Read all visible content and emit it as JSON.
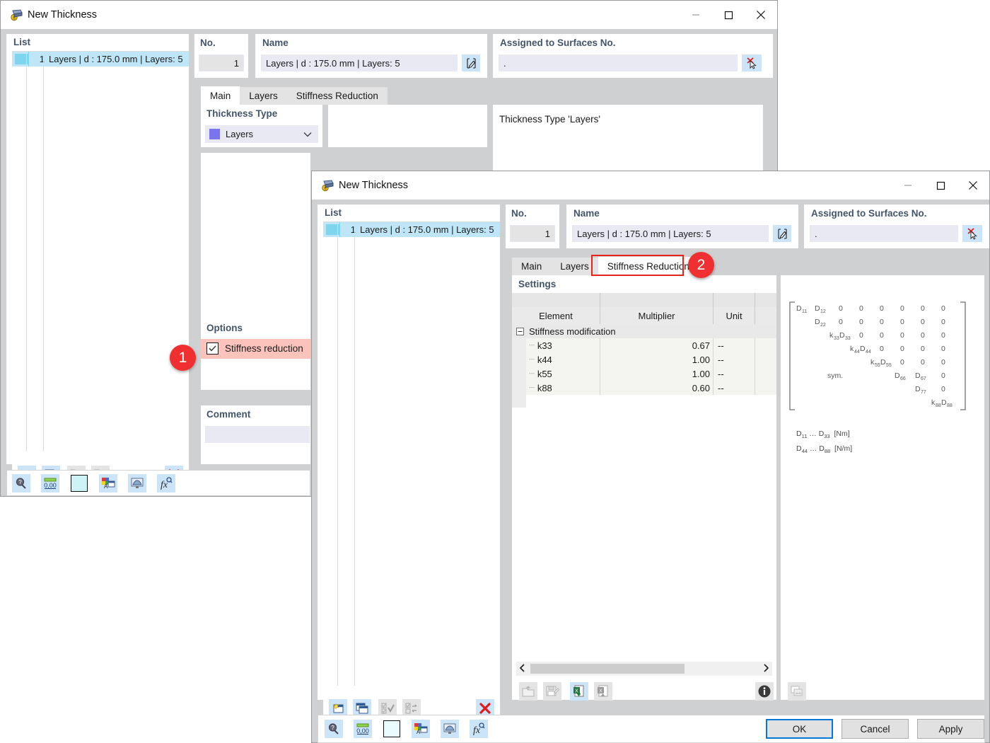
{
  "window_back": {
    "title": "New Thickness",
    "icon": "thickness-icon",
    "minimize": "minimize-icon",
    "maximize": "maximize-icon",
    "close": "close-icon",
    "list": {
      "title": "List",
      "rows": [
        {
          "num": "1",
          "label": "Layers | d : 175.0 mm | Layers: 5"
        }
      ]
    },
    "no": {
      "title": "No.",
      "value": "1"
    },
    "name": {
      "title": "Name",
      "value": "Layers | d : 175.0 mm | Layers: 5",
      "edit_icon": "edit-pencil-icon"
    },
    "assigned": {
      "title": "Assigned to Surfaces No.",
      "value": ".",
      "pick_icon": "pick-surface-icon"
    },
    "tabs": [
      {
        "label": "Main",
        "active": true
      },
      {
        "label": "Layers",
        "active": false
      },
      {
        "label": "Stiffness Reduction",
        "active": false
      }
    ],
    "thickness_type": {
      "title": "Thickness Type",
      "value": "Layers",
      "chevron": "chevron-down-icon"
    },
    "info_text": "Thickness Type  'Layers'",
    "options": {
      "title": "Options",
      "checkbox_label": "Stiffness reduction",
      "checked": true
    },
    "comment": {
      "title": "Comment",
      "value": ""
    },
    "list_toolbar": [
      {
        "icon": "new-item-icon",
        "enabled": true
      },
      {
        "icon": "copy-item-icon",
        "enabled": true
      },
      {
        "icon": "select-all-icon",
        "enabled": false
      },
      {
        "icon": "invert-selection-icon",
        "enabled": false
      },
      {
        "icon": "delete-red-x-icon",
        "enabled": true
      }
    ],
    "bottom_toolbar": [
      {
        "icon": "search-magnifier-icon"
      },
      {
        "icon": "units-00-icon"
      },
      {
        "icon": "color-swatch-icon"
      },
      {
        "icon": "display-properties-icon"
      },
      {
        "icon": "render-view-icon"
      },
      {
        "icon": "formula-fx-icon"
      }
    ]
  },
  "window_front": {
    "title": "New Thickness",
    "icon": "thickness-icon",
    "minimize": "minimize-icon",
    "maximize": "maximize-icon",
    "close": "close-icon",
    "list": {
      "title": "List",
      "rows": [
        {
          "num": "1",
          "label": "Layers | d : 175.0 mm | Layers: 5"
        }
      ]
    },
    "no": {
      "title": "No.",
      "value": "1"
    },
    "name": {
      "title": "Name",
      "value": "Layers | d : 175.0 mm | Layers: 5",
      "edit_icon": "edit-pencil-icon"
    },
    "assigned": {
      "title": "Assigned to Surfaces No.",
      "value": ".",
      "pick_icon": "pick-surface-icon"
    },
    "tabs": [
      {
        "label": "Main",
        "active": false
      },
      {
        "label": "Layers",
        "active": false
      },
      {
        "label": "Stiffness Reduction",
        "active": true
      }
    ],
    "settings": {
      "title": "Settings",
      "columns": [
        "Element",
        "Multiplier",
        "Unit"
      ],
      "group": {
        "label": "Stiffness modification",
        "expander": "collapse-minus-icon"
      },
      "rows": [
        {
          "element": "k33",
          "multiplier": "0.67",
          "unit": "--"
        },
        {
          "element": "k44",
          "multiplier": "1.00",
          "unit": "--"
        },
        {
          "element": "k55",
          "multiplier": "1.00",
          "unit": "--"
        },
        {
          "element": "k88",
          "multiplier": "0.60",
          "unit": "--"
        }
      ]
    },
    "matrix": {
      "rows": [
        [
          "D11",
          "D12",
          "0",
          "0",
          "0",
          "0",
          "0",
          "0"
        ],
        [
          "",
          "D22",
          "0",
          "0",
          "0",
          "0",
          "0",
          "0"
        ],
        [
          "",
          "",
          "k33D33",
          "0",
          "0",
          "0",
          "0",
          "0"
        ],
        [
          "",
          "",
          "",
          "k44D44",
          "0",
          "0",
          "0",
          "0"
        ],
        [
          "",
          "",
          "",
          "",
          "k55D55",
          "0",
          "0",
          "0"
        ],
        [
          "",
          "sym.",
          "",
          "",
          "",
          "D66",
          "D67",
          "0"
        ],
        [
          "",
          "",
          "",
          "",
          "",
          "",
          "D77",
          "0"
        ],
        [
          "",
          "",
          "",
          "",
          "",
          "",
          "",
          "k88D88"
        ]
      ],
      "legend": [
        "D11 ... D33  [Nm]",
        "D44 ... D88  [N/m]"
      ]
    },
    "settings_toolbar": [
      {
        "icon": "import-folder-icon",
        "enabled": false
      },
      {
        "icon": "save-disk-icon",
        "enabled": false
      },
      {
        "icon": "excel-export-icon",
        "enabled": true
      },
      {
        "icon": "excel-import-icon",
        "enabled": false
      },
      {
        "icon": "info-circle-icon",
        "enabled": true
      }
    ],
    "preview_toolbar": [
      {
        "icon": "copy-image-icon",
        "enabled": false
      }
    ],
    "hscroll": {
      "left_icon": "chevron-left-icon",
      "right_icon": "chevron-right-icon"
    },
    "list_toolbar": [
      {
        "icon": "new-item-icon",
        "enabled": true
      },
      {
        "icon": "copy-item-icon",
        "enabled": true
      },
      {
        "icon": "select-all-icon",
        "enabled": false
      },
      {
        "icon": "invert-selection-icon",
        "enabled": false
      },
      {
        "icon": "delete-red-x-icon",
        "enabled": true
      }
    ],
    "bottom_toolbar": [
      {
        "icon": "search-magnifier-icon"
      },
      {
        "icon": "units-00-icon"
      },
      {
        "icon": "color-swatch-icon"
      },
      {
        "icon": "display-properties-icon"
      },
      {
        "icon": "render-view-icon"
      },
      {
        "icon": "formula-fx-icon"
      }
    ],
    "buttons": {
      "ok": "OK",
      "cancel": "Cancel",
      "apply": "Apply"
    }
  },
  "annotations": [
    {
      "id": "1",
      "label": "1",
      "target": "stiffness-reduction-checkbox"
    },
    {
      "id": "2",
      "label": "2",
      "target": "tab-stiffness-reduction"
    }
  ],
  "colors": {
    "accent_blue": "#0078d7",
    "badge_red": "#f03030",
    "highlight_red": "#e8231a",
    "highlight_fill": "#fcc3bd",
    "selection_blue": "#bfe6f7",
    "field_lavender": "#e8e9f3",
    "header_text": "#44546a"
  }
}
